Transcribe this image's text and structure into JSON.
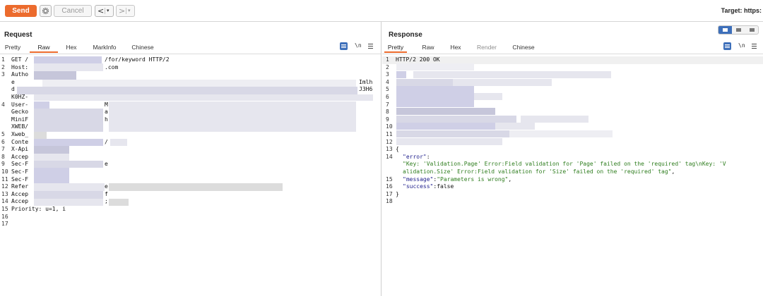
{
  "toolbar": {
    "send_label": "Send",
    "cancel_label": "Cancel",
    "back_arrow": "<",
    "fwd_arrow": ">",
    "caret": "▾",
    "target_label": "Target: https:"
  },
  "colors": {
    "send": "#ec6b2d",
    "active_tab_underline": "#ec6b2d",
    "toggle_active": "#3d6fba"
  },
  "request": {
    "title": "Request",
    "tabs": [
      {
        "label": "Pretty",
        "active": false
      },
      {
        "label": "Raw",
        "active": true
      },
      {
        "label": "Hex",
        "active": false
      },
      {
        "label": "MarkInfo",
        "active": false
      },
      {
        "label": "Chinese",
        "active": false
      }
    ],
    "newline_toggle": "\\n",
    "lines": [
      {
        "n": "1",
        "text": "GET /",
        "tail": "/for/keyword HTTP/2"
      },
      {
        "n": "2",
        "text": "Host:",
        "tail": ".com"
      },
      {
        "n": "3",
        "text": "Autho"
      },
      {
        "n": "",
        "text": "e",
        "tail": "Imlh"
      },
      {
        "n": "",
        "text": "d",
        "tail": "J3H6"
      },
      {
        "n": "",
        "text": "K0HZ-"
      },
      {
        "n": "4",
        "text": "User-",
        "tail": "M"
      },
      {
        "n": "",
        "text": "Gecko",
        "tail": "a"
      },
      {
        "n": "",
        "text": "MiniF",
        "tail": "h"
      },
      {
        "n": "",
        "text": "XWEB/"
      },
      {
        "n": "5",
        "text": "Xweb_"
      },
      {
        "n": "6",
        "text": "Conte",
        "tail": "/"
      },
      {
        "n": "7",
        "text": "X-Api"
      },
      {
        "n": "8",
        "text": "Accep"
      },
      {
        "n": "9",
        "text": "Sec-F",
        "tail": "e"
      },
      {
        "n": "10",
        "text": "Sec-F"
      },
      {
        "n": "11",
        "text": "Sec-F"
      },
      {
        "n": "12",
        "text": "Refer",
        "tail": "e"
      },
      {
        "n": "13",
        "text": "Accep",
        "tail": "f"
      },
      {
        "n": "14",
        "text": "Accep",
        "tail": ";"
      },
      {
        "n": "15",
        "text": "Priority: u=1, i"
      },
      {
        "n": "16",
        "text": ""
      },
      {
        "n": "17",
        "text": ""
      }
    ]
  },
  "response": {
    "title": "Response",
    "tabs": [
      {
        "label": "Pretty",
        "active": true
      },
      {
        "label": "Raw",
        "active": false
      },
      {
        "label": "Hex",
        "active": false
      },
      {
        "label": "Render",
        "active": false,
        "disabled": true
      },
      {
        "label": "Chinese",
        "active": false
      }
    ],
    "newline_toggle": "\\n",
    "status_line": "HTTP/2 200 OK",
    "line_numbers": [
      "1",
      "2",
      "3",
      "4",
      "5",
      "6",
      "7",
      "8",
      "9",
      "10",
      "11",
      "12",
      "13",
      "14",
      "",
      "15",
      "16",
      "17",
      "18"
    ],
    "json": {
      "open": "{",
      "error_key": "\"error\"",
      "error_colon": ":",
      "error_value_1": "\"Key: 'Validation.Page' Error:Field validation for 'Page' failed on the 'required' tag\\nKey: 'V",
      "error_value_2": "alidation.Size' Error:Field validation for 'Size' failed on the 'required' tag\"",
      "error_comma": ",",
      "message_key": "\"message\"",
      "message_value": "\"Parameters is wrong\"",
      "message_comma": ",",
      "success_key": "\"success\"",
      "success_value": "false",
      "close": "}",
      "colon": ":"
    }
  }
}
